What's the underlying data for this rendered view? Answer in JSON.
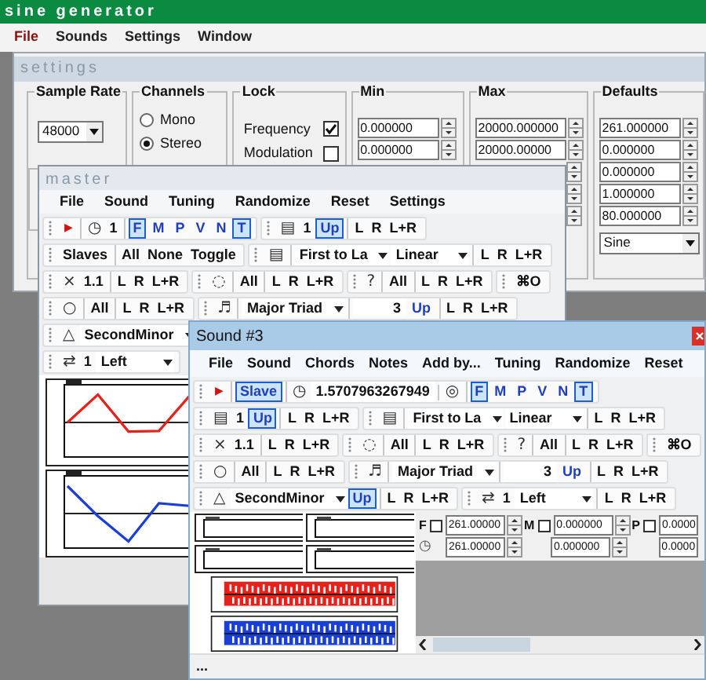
{
  "app": {
    "title": "sine generator",
    "menu": [
      "File",
      "Sounds",
      "Settings",
      "Window"
    ]
  },
  "settings": {
    "title": "settings",
    "sample_rate": {
      "label": "Sample Rate",
      "value": "48000"
    },
    "channels": {
      "label": "Channels",
      "options": [
        {
          "label": "Mono",
          "selected": false
        },
        {
          "label": "Stereo",
          "selected": true
        }
      ]
    },
    "lock": {
      "label": "Lock",
      "items": [
        {
          "label": "Frequency",
          "checked": true
        },
        {
          "label": "Modulation",
          "checked": false
        }
      ]
    },
    "min": {
      "label": "Min",
      "values": [
        "0.000000",
        "0.000000"
      ]
    },
    "max": {
      "label": "Max",
      "values": [
        "20000.000000",
        "20000.00000"
      ]
    },
    "defaults": {
      "label": "Defaults",
      "values": [
        "261.000000",
        "0.000000",
        "0.000000",
        "1.000000",
        "80.000000"
      ],
      "waveform": "Sine"
    }
  },
  "master": {
    "title": "master",
    "menu": [
      "File",
      "Sound",
      "Tuning",
      "Randomize",
      "Reset",
      "Settings"
    ],
    "toolbars": [
      [
        [
          [
            {
              "kind": "play",
              "text": "▶"
            }
          ],
          [
            {
              "kind": "glyph",
              "text": "◷"
            },
            {
              "kind": "text",
              "text": "1"
            }
          ],
          [
            {
              "kind": "toggle",
              "text": "F",
              "selected": true
            },
            {
              "kind": "toggle",
              "text": "M",
              "selected": false
            },
            {
              "kind": "toggle",
              "text": "P",
              "selected": false
            },
            {
              "kind": "toggle",
              "text": "V",
              "selected": false
            },
            {
              "kind": "toggle",
              "text": "N",
              "selected": false
            },
            {
              "kind": "toggle",
              "text": "T",
              "selected": true
            }
          ]
        ],
        [
          [
            {
              "kind": "glyph",
              "text": "▤"
            },
            {
              "kind": "text",
              "text": "1"
            },
            {
              "kind": "toggle",
              "text": "Up",
              "selected": true
            }
          ],
          [
            {
              "kind": "button",
              "text": "L"
            },
            {
              "kind": "button",
              "text": "R"
            },
            {
              "kind": "button",
              "text": "L+R"
            }
          ]
        ]
      ],
      [
        [
          [
            {
              "kind": "text",
              "text": "Slaves"
            }
          ],
          [
            {
              "kind": "button",
              "text": "All"
            },
            {
              "kind": "button",
              "text": "None"
            },
            {
              "kind": "button",
              "text": "Toggle"
            }
          ]
        ],
        [
          [
            {
              "kind": "glyph",
              "text": "▤"
            }
          ],
          [
            {
              "kind": "select",
              "text": "First to La"
            },
            {
              "kind": "select",
              "text": "Linear"
            }
          ],
          [
            {
              "kind": "button",
              "text": "L"
            },
            {
              "kind": "button",
              "text": "R"
            },
            {
              "kind": "button",
              "text": "L+R"
            }
          ]
        ]
      ],
      [
        [
          [
            {
              "kind": "glyph",
              "text": "×"
            },
            {
              "kind": "text",
              "text": "1.1"
            }
          ],
          [
            {
              "kind": "button",
              "text": "L"
            },
            {
              "kind": "button",
              "text": "R"
            },
            {
              "kind": "button",
              "text": "L+R"
            }
          ]
        ],
        [
          [
            {
              "kind": "glyph",
              "text": "◌"
            }
          ],
          [
            {
              "kind": "button",
              "text": "All"
            }
          ],
          [
            {
              "kind": "button",
              "text": "L"
            },
            {
              "kind": "button",
              "text": "R"
            },
            {
              "kind": "button",
              "text": "L+R"
            }
          ]
        ],
        [
          [
            {
              "kind": "glyph",
              "text": "?"
            }
          ],
          [
            {
              "kind": "button",
              "text": "All"
            }
          ],
          [
            {
              "kind": "button",
              "text": "L"
            },
            {
              "kind": "button",
              "text": "R"
            },
            {
              "kind": "button",
              "text": "L+R"
            }
          ]
        ],
        [
          [
            {
              "kind": "button",
              "text": "⌘O"
            }
          ]
        ]
      ],
      [
        [
          [
            {
              "kind": "glyph",
              "text": "○"
            }
          ],
          [
            {
              "kind": "button",
              "text": "All"
            }
          ],
          [
            {
              "kind": "button",
              "text": "L"
            },
            {
              "kind": "button",
              "text": "R"
            },
            {
              "kind": "button",
              "text": "L+R"
            }
          ]
        ],
        [
          [
            {
              "kind": "glyph",
              "text": "♬"
            }
          ],
          [
            {
              "kind": "select",
              "text": "Major Triad"
            }
          ],
          [
            {
              "kind": "field",
              "text": "3"
            },
            {
              "kind": "toggle",
              "text": "Up",
              "selected": false
            }
          ],
          [
            {
              "kind": "button",
              "text": "L"
            },
            {
              "kind": "button",
              "text": "R"
            },
            {
              "kind": "button",
              "text": "L+R"
            }
          ]
        ]
      ],
      [
        [
          [
            {
              "kind": "glyph",
              "text": "△"
            },
            {
              "kind": "select",
              "text": "SecondMinor"
            }
          ]
        ]
      ],
      [
        [
          [
            {
              "kind": "glyph",
              "text": "⇄"
            },
            {
              "kind": "text",
              "text": "1"
            },
            {
              "kind": "select",
              "text": "Left"
            }
          ]
        ]
      ]
    ],
    "plots": [
      {
        "color": "#e8201a"
      },
      {
        "color": "#1a3fd6"
      }
    ]
  },
  "sound": {
    "title": "Sound #3",
    "menu": [
      "File",
      "Sound",
      "Chords",
      "Notes",
      "Add by...",
      "Tuning",
      "Randomize",
      "Reset"
    ],
    "toolbars": [
      [
        [
          [
            {
              "kind": "play",
              "text": "▶"
            }
          ],
          [
            {
              "kind": "toggle",
              "text": "Slave",
              "selected": true
            }
          ],
          [
            {
              "kind": "glyph",
              "text": "◷"
            },
            {
              "kind": "field",
              "text": "1.5707963267949"
            }
          ],
          [
            {
              "kind": "glyph",
              "text": "◎"
            }
          ],
          [
            {
              "kind": "toggle",
              "text": "F",
              "selected": true
            },
            {
              "kind": "toggle",
              "text": "M",
              "selected": false
            },
            {
              "kind": "toggle",
              "text": "P",
              "selected": false
            },
            {
              "kind": "toggle",
              "text": "V",
              "selected": false
            },
            {
              "kind": "toggle",
              "text": "N",
              "selected": false
            },
            {
              "kind": "toggle",
              "text": "T",
              "selected": true
            }
          ]
        ]
      ],
      [
        [
          [
            {
              "kind": "glyph",
              "text": "▤"
            },
            {
              "kind": "text",
              "text": "1"
            },
            {
              "kind": "toggle",
              "text": "Up",
              "selected": true
            }
          ],
          [
            {
              "kind": "button",
              "text": "L"
            },
            {
              "kind": "button",
              "text": "R"
            },
            {
              "kind": "button",
              "text": "L+R"
            }
          ]
        ],
        [
          [
            {
              "kind": "glyph",
              "text": "▤"
            }
          ],
          [
            {
              "kind": "select",
              "text": "First to La"
            },
            {
              "kind": "select",
              "text": "Linear"
            }
          ],
          [
            {
              "kind": "button",
              "text": "L"
            },
            {
              "kind": "button",
              "text": "R"
            },
            {
              "kind": "button",
              "text": "L+R"
            }
          ]
        ]
      ],
      [
        [
          [
            {
              "kind": "glyph",
              "text": "×"
            },
            {
              "kind": "text",
              "text": "1.1"
            }
          ],
          [
            {
              "kind": "button",
              "text": "L"
            },
            {
              "kind": "button",
              "text": "R"
            },
            {
              "kind": "button",
              "text": "L+R"
            }
          ]
        ],
        [
          [
            {
              "kind": "glyph",
              "text": "◌"
            }
          ],
          [
            {
              "kind": "button",
              "text": "All"
            }
          ],
          [
            {
              "kind": "button",
              "text": "L"
            },
            {
              "kind": "button",
              "text": "R"
            },
            {
              "kind": "button",
              "text": "L+R"
            }
          ]
        ],
        [
          [
            {
              "kind": "glyph",
              "text": "?"
            }
          ],
          [
            {
              "kind": "button",
              "text": "All"
            }
          ],
          [
            {
              "kind": "button",
              "text": "L"
            },
            {
              "kind": "button",
              "text": "R"
            },
            {
              "kind": "button",
              "text": "L+R"
            }
          ]
        ],
        [
          [
            {
              "kind": "button",
              "text": "⌘O"
            }
          ]
        ]
      ],
      [
        [
          [
            {
              "kind": "glyph",
              "text": "○"
            }
          ],
          [
            {
              "kind": "button",
              "text": "All"
            }
          ],
          [
            {
              "kind": "button",
              "text": "L"
            },
            {
              "kind": "button",
              "text": "R"
            },
            {
              "kind": "button",
              "text": "L+R"
            }
          ]
        ],
        [
          [
            {
              "kind": "glyph",
              "text": "♬"
            }
          ],
          [
            {
              "kind": "select",
              "text": "Major Triad"
            }
          ],
          [
            {
              "kind": "field",
              "text": "3"
            },
            {
              "kind": "toggle",
              "text": "Up",
              "selected": false
            }
          ],
          [
            {
              "kind": "button",
              "text": "L"
            },
            {
              "kind": "button",
              "text": "R"
            },
            {
              "kind": "button",
              "text": "L+R"
            }
          ]
        ]
      ],
      [
        [
          [
            {
              "kind": "glyph",
              "text": "△"
            },
            {
              "kind": "select",
              "text": "SecondMinor"
            },
            {
              "kind": "toggle",
              "text": "Up",
              "selected": true
            }
          ],
          [
            {
              "kind": "button",
              "text": "L"
            },
            {
              "kind": "button",
              "text": "R"
            },
            {
              "kind": "button",
              "text": "L+R"
            }
          ]
        ],
        [
          [
            {
              "kind": "glyph",
              "text": "⇄"
            },
            {
              "kind": "text",
              "text": "1"
            },
            {
              "kind": "select",
              "text": "Left"
            }
          ],
          [
            {
              "kind": "button",
              "text": "L"
            },
            {
              "kind": "button",
              "text": "R"
            },
            {
              "kind": "button",
              "text": "L+R"
            }
          ]
        ]
      ]
    ],
    "plots": [
      {
        "color": "#e8201a"
      },
      {
        "color": "#1a3fd6"
      }
    ],
    "params": [
      {
        "label": "F",
        "checked": false,
        "values": [
          "261.00000",
          "261.00000"
        ]
      },
      {
        "label": "M",
        "checked": false,
        "values": [
          "0.000000",
          "0.000000"
        ]
      },
      {
        "label": "P",
        "checked": false,
        "values": [
          "0.0000",
          "0.0000"
        ]
      }
    ],
    "param_icon": "◷",
    "status": "..."
  }
}
